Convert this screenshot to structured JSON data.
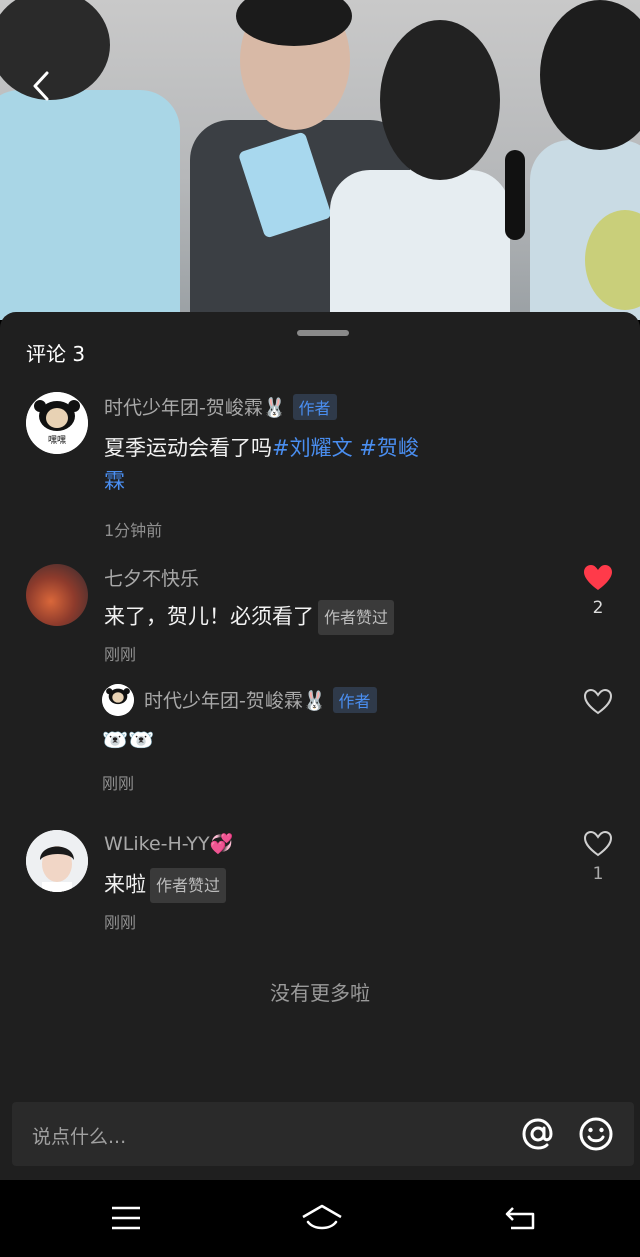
{
  "header": {
    "back_icon": "chevron-left-icon"
  },
  "comments_panel": {
    "title": "评论 3",
    "comments": [
      {
        "username": "时代少年团-贺峻霖🐰",
        "author_badge": "作者",
        "text_plain": "夏季运动会看了吗",
        "tag1": "#刘耀文",
        "tag2_part1": "#贺峻",
        "tag2_part2": "霖",
        "time": "1分钟前"
      },
      {
        "username": "七夕不快乐",
        "text": "来了，贺儿！必须看了",
        "liked_badge": "作者赞过",
        "time": "刚刚",
        "like_count": "2",
        "liked": true,
        "reply": {
          "username": "时代少年团-贺峻霖🐰",
          "author_badge": "作者",
          "text": "🐻‍❄️🐻‍❄️",
          "time": "刚刚"
        }
      },
      {
        "username": "WLike-H-YY💞",
        "text": "来啦",
        "liked_badge": "作者赞过",
        "time": "刚刚",
        "like_count": "1",
        "liked": false
      }
    ],
    "no_more": "没有更多啦"
  },
  "input": {
    "placeholder": "说点什么...",
    "at_icon": "at-icon",
    "emoji_icon": "smiley-icon"
  },
  "system_nav": {
    "menu_icon": "menu-icon",
    "home_icon": "home-icon",
    "back_icon": "back-arrow-icon"
  },
  "colors": {
    "sheet_bg": "#1f1f1f",
    "accent": "#4a8ef0",
    "like_red": "#ff3a4a"
  }
}
